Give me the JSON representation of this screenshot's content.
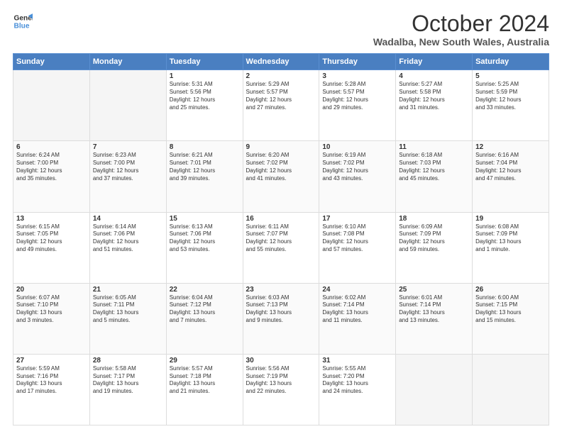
{
  "header": {
    "logo_line1": "General",
    "logo_line2": "Blue",
    "month": "October 2024",
    "location": "Wadalba, New South Wales, Australia"
  },
  "days_of_week": [
    "Sunday",
    "Monday",
    "Tuesday",
    "Wednesday",
    "Thursday",
    "Friday",
    "Saturday"
  ],
  "weeks": [
    [
      {
        "day": "",
        "empty": true
      },
      {
        "day": "",
        "empty": true
      },
      {
        "day": "1",
        "line1": "Sunrise: 5:31 AM",
        "line2": "Sunset: 5:56 PM",
        "line3": "Daylight: 12 hours",
        "line4": "and 25 minutes."
      },
      {
        "day": "2",
        "line1": "Sunrise: 5:29 AM",
        "line2": "Sunset: 5:57 PM",
        "line3": "Daylight: 12 hours",
        "line4": "and 27 minutes."
      },
      {
        "day": "3",
        "line1": "Sunrise: 5:28 AM",
        "line2": "Sunset: 5:57 PM",
        "line3": "Daylight: 12 hours",
        "line4": "and 29 minutes."
      },
      {
        "day": "4",
        "line1": "Sunrise: 5:27 AM",
        "line2": "Sunset: 5:58 PM",
        "line3": "Daylight: 12 hours",
        "line4": "and 31 minutes."
      },
      {
        "day": "5",
        "line1": "Sunrise: 5:25 AM",
        "line2": "Sunset: 5:59 PM",
        "line3": "Daylight: 12 hours",
        "line4": "and 33 minutes."
      }
    ],
    [
      {
        "day": "6",
        "line1": "Sunrise: 6:24 AM",
        "line2": "Sunset: 7:00 PM",
        "line3": "Daylight: 12 hours",
        "line4": "and 35 minutes."
      },
      {
        "day": "7",
        "line1": "Sunrise: 6:23 AM",
        "line2": "Sunset: 7:00 PM",
        "line3": "Daylight: 12 hours",
        "line4": "and 37 minutes."
      },
      {
        "day": "8",
        "line1": "Sunrise: 6:21 AM",
        "line2": "Sunset: 7:01 PM",
        "line3": "Daylight: 12 hours",
        "line4": "and 39 minutes."
      },
      {
        "day": "9",
        "line1": "Sunrise: 6:20 AM",
        "line2": "Sunset: 7:02 PM",
        "line3": "Daylight: 12 hours",
        "line4": "and 41 minutes."
      },
      {
        "day": "10",
        "line1": "Sunrise: 6:19 AM",
        "line2": "Sunset: 7:02 PM",
        "line3": "Daylight: 12 hours",
        "line4": "and 43 minutes."
      },
      {
        "day": "11",
        "line1": "Sunrise: 6:18 AM",
        "line2": "Sunset: 7:03 PM",
        "line3": "Daylight: 12 hours",
        "line4": "and 45 minutes."
      },
      {
        "day": "12",
        "line1": "Sunrise: 6:16 AM",
        "line2": "Sunset: 7:04 PM",
        "line3": "Daylight: 12 hours",
        "line4": "and 47 minutes."
      }
    ],
    [
      {
        "day": "13",
        "line1": "Sunrise: 6:15 AM",
        "line2": "Sunset: 7:05 PM",
        "line3": "Daylight: 12 hours",
        "line4": "and 49 minutes."
      },
      {
        "day": "14",
        "line1": "Sunrise: 6:14 AM",
        "line2": "Sunset: 7:06 PM",
        "line3": "Daylight: 12 hours",
        "line4": "and 51 minutes."
      },
      {
        "day": "15",
        "line1": "Sunrise: 6:13 AM",
        "line2": "Sunset: 7:06 PM",
        "line3": "Daylight: 12 hours",
        "line4": "and 53 minutes."
      },
      {
        "day": "16",
        "line1": "Sunrise: 6:11 AM",
        "line2": "Sunset: 7:07 PM",
        "line3": "Daylight: 12 hours",
        "line4": "and 55 minutes."
      },
      {
        "day": "17",
        "line1": "Sunrise: 6:10 AM",
        "line2": "Sunset: 7:08 PM",
        "line3": "Daylight: 12 hours",
        "line4": "and 57 minutes."
      },
      {
        "day": "18",
        "line1": "Sunrise: 6:09 AM",
        "line2": "Sunset: 7:09 PM",
        "line3": "Daylight: 12 hours",
        "line4": "and 59 minutes."
      },
      {
        "day": "19",
        "line1": "Sunrise: 6:08 AM",
        "line2": "Sunset: 7:09 PM",
        "line3": "Daylight: 13 hours",
        "line4": "and 1 minute."
      }
    ],
    [
      {
        "day": "20",
        "line1": "Sunrise: 6:07 AM",
        "line2": "Sunset: 7:10 PM",
        "line3": "Daylight: 13 hours",
        "line4": "and 3 minutes."
      },
      {
        "day": "21",
        "line1": "Sunrise: 6:05 AM",
        "line2": "Sunset: 7:11 PM",
        "line3": "Daylight: 13 hours",
        "line4": "and 5 minutes."
      },
      {
        "day": "22",
        "line1": "Sunrise: 6:04 AM",
        "line2": "Sunset: 7:12 PM",
        "line3": "Daylight: 13 hours",
        "line4": "and 7 minutes."
      },
      {
        "day": "23",
        "line1": "Sunrise: 6:03 AM",
        "line2": "Sunset: 7:13 PM",
        "line3": "Daylight: 13 hours",
        "line4": "and 9 minutes."
      },
      {
        "day": "24",
        "line1": "Sunrise: 6:02 AM",
        "line2": "Sunset: 7:14 PM",
        "line3": "Daylight: 13 hours",
        "line4": "and 11 minutes."
      },
      {
        "day": "25",
        "line1": "Sunrise: 6:01 AM",
        "line2": "Sunset: 7:14 PM",
        "line3": "Daylight: 13 hours",
        "line4": "and 13 minutes."
      },
      {
        "day": "26",
        "line1": "Sunrise: 6:00 AM",
        "line2": "Sunset: 7:15 PM",
        "line3": "Daylight: 13 hours",
        "line4": "and 15 minutes."
      }
    ],
    [
      {
        "day": "27",
        "line1": "Sunrise: 5:59 AM",
        "line2": "Sunset: 7:16 PM",
        "line3": "Daylight: 13 hours",
        "line4": "and 17 minutes."
      },
      {
        "day": "28",
        "line1": "Sunrise: 5:58 AM",
        "line2": "Sunset: 7:17 PM",
        "line3": "Daylight: 13 hours",
        "line4": "and 19 minutes."
      },
      {
        "day": "29",
        "line1": "Sunrise: 5:57 AM",
        "line2": "Sunset: 7:18 PM",
        "line3": "Daylight: 13 hours",
        "line4": "and 21 minutes."
      },
      {
        "day": "30",
        "line1": "Sunrise: 5:56 AM",
        "line2": "Sunset: 7:19 PM",
        "line3": "Daylight: 13 hours",
        "line4": "and 22 minutes."
      },
      {
        "day": "31",
        "line1": "Sunrise: 5:55 AM",
        "line2": "Sunset: 7:20 PM",
        "line3": "Daylight: 13 hours",
        "line4": "and 24 minutes."
      },
      {
        "day": "",
        "empty": true
      },
      {
        "day": "",
        "empty": true
      }
    ]
  ]
}
